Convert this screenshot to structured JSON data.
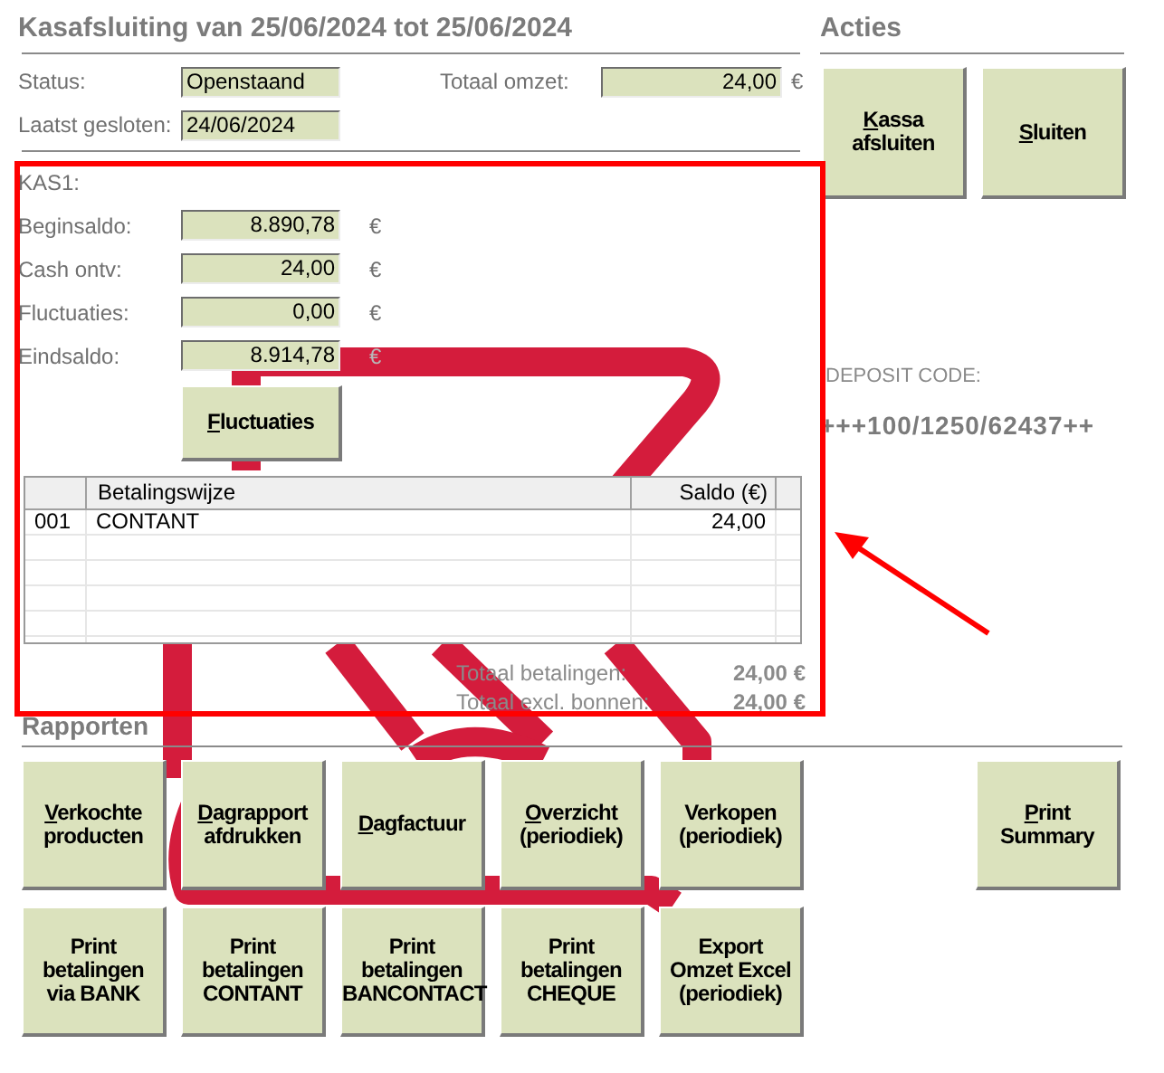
{
  "header": {
    "title": "Kasafsluiting van 25/06/2024 tot 25/06/2024"
  },
  "summary": {
    "status": {
      "label": "Status:",
      "value": "Openstaand"
    },
    "last_closed": {
      "label": "Laatst gesloten:",
      "value": "24/06/2024"
    },
    "total_revenue": {
      "label": "Totaal omzet:",
      "value": "24,00",
      "currency": "€"
    }
  },
  "register": {
    "title": "KAS1:",
    "fields": [
      {
        "label": "Beginsaldo:",
        "value": "8.890,78",
        "currency": "€",
        "dimmed": false
      },
      {
        "label": "Cash ontv:",
        "value": "24,00",
        "currency": "€",
        "dimmed": false
      },
      {
        "label": "Fluctuaties:",
        "value": "0,00",
        "currency": "€",
        "dimmed": false
      },
      {
        "label": "Eindsaldo:",
        "value": "8.914,78",
        "currency": "€",
        "dimmed": true
      }
    ],
    "button": {
      "label": "Fluctuaties",
      "hotkey": true
    }
  },
  "table": {
    "columns": [
      {
        "label": "Betalingswijze"
      },
      {
        "label": "Saldo (€)"
      }
    ],
    "rows": [
      {
        "code": "001",
        "method": "CONTANT",
        "balance": "24,00"
      }
    ]
  },
  "totals": [
    {
      "label": "Totaal betalingen:",
      "value": "24,00 €"
    },
    {
      "label": "Totaal excl. bonnen:",
      "value": "24,00 €"
    }
  ],
  "actions": {
    "title": "Acties",
    "buttons": [
      {
        "label": "Kassa\nafsluiten",
        "hotkey": true
      },
      {
        "label": "Sluiten",
        "hotkey": true
      }
    ],
    "deposit_code": {
      "label": "DEPOSIT CODE:",
      "value": "+++100/1250/62437++"
    }
  },
  "reports": {
    "title": "Rapporten",
    "rows": [
      {
        "buttons": [
          {
            "label": "Verkochte\nproducten",
            "hotkey": true
          },
          {
            "label": "Dagrapport\nafdrukken",
            "hotkey": true
          },
          {
            "label": "Dagfactuur",
            "hotkey": true
          },
          {
            "label": "Overzicht\n(periodiek)",
            "hotkey": true
          },
          {
            "label": "Verkopen\n(periodiek)",
            "hotkey": false
          }
        ],
        "side_button": {
          "label": "Print\nSummary",
          "hotkey": true
        }
      },
      {
        "buttons": [
          {
            "label": "Print\nbetalingen\nvia BANK",
            "hotkey": false
          },
          {
            "label": "Print\nbetalingen\nCONTANT",
            "hotkey": false
          },
          {
            "label": "Print\nbetalingen\nBANCONTACT",
            "hotkey": false
          },
          {
            "label": "Print\nbetalingen\nCHEQUE",
            "hotkey": false
          },
          {
            "label": "Export\nOmzet Excel\n(periodiek)",
            "hotkey": false
          }
        ]
      }
    ]
  }
}
